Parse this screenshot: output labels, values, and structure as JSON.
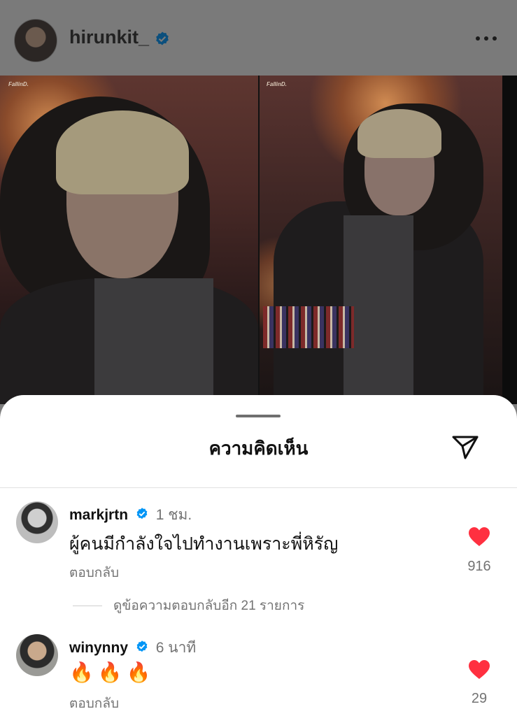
{
  "post": {
    "username": "hirunkit_",
    "verified": true,
    "watermark_left": "FallinD.",
    "watermark_right": "FallinD."
  },
  "sheet": {
    "title": "ความคิดเห็น"
  },
  "comments": [
    {
      "username": "markjrtn",
      "verified": true,
      "time": "1 ชม.",
      "text": "ผู้คนมีกำลังใจไปทำงานเพราะพี่หิรัญ",
      "reply_label": "ตอบกลับ",
      "likes": "916",
      "view_replies": "ดูข้อความตอบกลับอีก 21 รายการ"
    },
    {
      "username": "winynny",
      "verified": true,
      "time": "6 นาที",
      "text": "🔥🔥🔥",
      "reply_label": "ตอบกลับ",
      "likes": "29"
    }
  ],
  "colors": {
    "heart": "#ff3040",
    "verified_badge": "#0095f6",
    "dim_overlay": "#7a7a7a"
  }
}
